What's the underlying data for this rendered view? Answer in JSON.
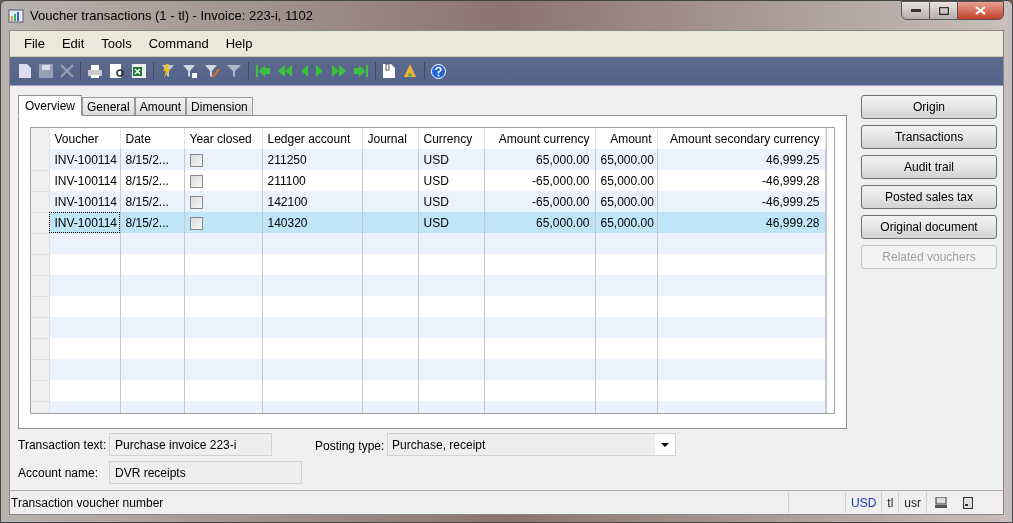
{
  "window": {
    "title": "Voucher transactions (1 - tl) - Invoice: 223-i, 1102"
  },
  "menu": [
    "File",
    "Edit",
    "Tools",
    "Command",
    "Help"
  ],
  "tabs": [
    {
      "label": "Overview",
      "selected": true
    },
    {
      "label": "General",
      "selected": false
    },
    {
      "label": "Amount",
      "selected": false
    },
    {
      "label": "Dimension",
      "selected": false
    }
  ],
  "grid": {
    "columns": [
      {
        "label": "Voucher",
        "kind": "text"
      },
      {
        "label": "Date",
        "kind": "text"
      },
      {
        "label": "Year closed",
        "kind": "checkbox"
      },
      {
        "label": "Ledger account",
        "kind": "text"
      },
      {
        "label": "Journal",
        "kind": "text"
      },
      {
        "label": "Currency",
        "kind": "text"
      },
      {
        "label": "Amount currency",
        "kind": "number"
      },
      {
        "label": "Amount",
        "kind": "number"
      },
      {
        "label": "Amount secondary currency",
        "kind": "number"
      }
    ],
    "rows": [
      {
        "cells": [
          "INV-100114",
          "8/15/2...",
          null,
          "211250",
          null,
          "USD",
          "65,000.00",
          "65,000.00",
          "46,999.25"
        ],
        "year_closed": false,
        "selected": false
      },
      {
        "cells": [
          "INV-100114",
          "8/15/2...",
          null,
          "211100",
          null,
          "USD",
          "-65,000.00",
          "65,000.00",
          "-46,999.28"
        ],
        "year_closed": false,
        "selected": false
      },
      {
        "cells": [
          "INV-100114",
          "8/15/2...",
          null,
          "142100",
          null,
          "USD",
          "-65,000.00",
          "65,000.00",
          "-46,999.25"
        ],
        "year_closed": false,
        "selected": false
      },
      {
        "cells": [
          "INV-100114",
          "8/15/2...",
          null,
          "140320",
          null,
          "USD",
          "65,000.00",
          "65,000.00",
          "46,999.28"
        ],
        "year_closed": false,
        "selected": true
      }
    ]
  },
  "buttons": [
    {
      "label": "Origin",
      "disabled": false
    },
    {
      "label": "Transactions",
      "disabled": false
    },
    {
      "label": "Audit trail",
      "disabled": false
    },
    {
      "label": "Posted sales tax",
      "disabled": false
    },
    {
      "label": "Original document",
      "disabled": false
    },
    {
      "label": "Related vouchers",
      "disabled": true
    }
  ],
  "transaction_text": {
    "label": "Transaction text:",
    "value": "Purchase invoice 223-i"
  },
  "account_name": {
    "label": "Account name:",
    "value": "DVR receipts"
  },
  "posting_type": {
    "label": "Posting type:",
    "value": "Purchase, receipt"
  },
  "status_bar": {
    "text": "Transaction voucher number",
    "currency": "USD",
    "company": "tl",
    "user": "usr"
  }
}
